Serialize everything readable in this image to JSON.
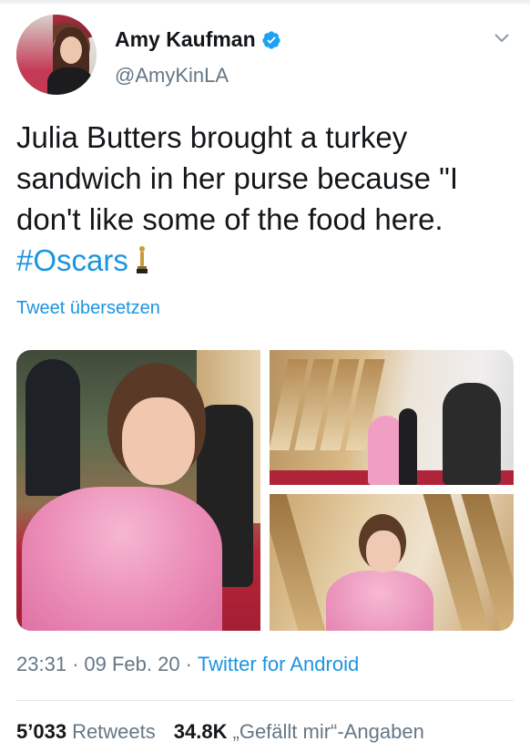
{
  "author": {
    "display_name": "Amy Kaufman",
    "handle": "@AmyKinLA",
    "verified": true,
    "verified_icon": "verified-badge-icon",
    "avatar_icon": "avatar"
  },
  "tweet": {
    "text_main": "Julia Butters brought a turkey sandwich in her purse because \"I don't like some of the food here.",
    "hashtag": "#Oscars",
    "trailing_icon": "oscar-statuette-icon",
    "translate_label": "Tweet übersetzen"
  },
  "media": {
    "photo_count": 3
  },
  "meta": {
    "time": "23:31",
    "separator_1": "·",
    "date": "09 Feb. 20",
    "separator_2": "·",
    "source": "Twitter for Android"
  },
  "stats": {
    "retweets_count": "5’033",
    "retweets_label": "Retweets",
    "likes_count": "34.8K",
    "likes_label": "„Gefällt mir“-Angaben"
  },
  "colors": {
    "link": "#1b95e0",
    "secondary_text": "#657786",
    "primary_text": "#14171a"
  }
}
